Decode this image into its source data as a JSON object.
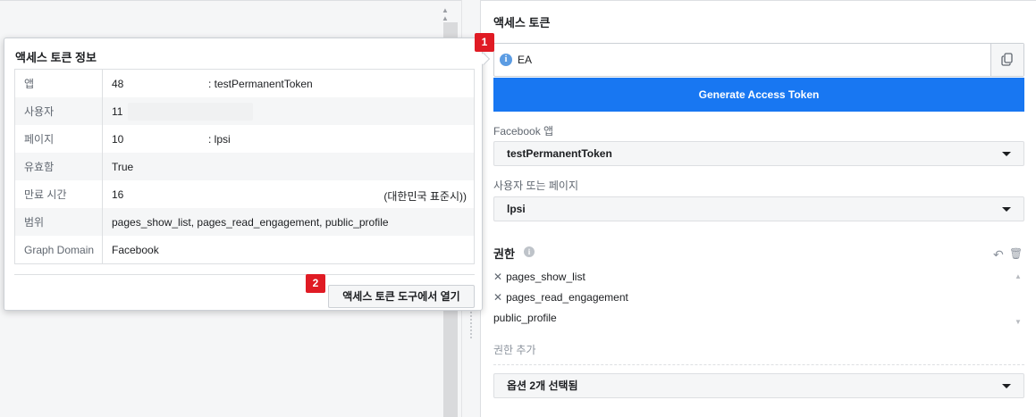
{
  "right_panel": {
    "section_title": "액세스 토큰",
    "token_value": "EA",
    "generate_button": "Generate Access Token",
    "facebook_app_label": "Facebook 앱",
    "facebook_app_value": "testPermanentToken",
    "user_or_page_label": "사용자 또는 페이지",
    "user_or_page_value": "lpsi",
    "permissions_title": "권한",
    "permissions": [
      {
        "label": "pages_show_list",
        "removable": true
      },
      {
        "label": "pages_read_engagement",
        "removable": true
      },
      {
        "label": "public_profile",
        "removable": false
      }
    ],
    "add_permission_placeholder": "권한 추가",
    "options_select_value": "옵션 2개 선택됨"
  },
  "popover": {
    "title": "액세스 토큰 정보",
    "rows": [
      {
        "key": "앱",
        "value": "48",
        "sub": ": testPermanentToken",
        "right": ""
      },
      {
        "key": "사용자",
        "value": "11",
        "sub": "",
        "right": ""
      },
      {
        "key": "페이지",
        "value": "10",
        "sub": ": lpsi",
        "right": ""
      },
      {
        "key": "유효함",
        "value": "True",
        "sub": "",
        "right": ""
      },
      {
        "key": "만료 시간",
        "value": "16",
        "sub": "",
        "right": "(대한민국 표준시))"
      },
      {
        "key": "범위",
        "value": "pages_show_list, pages_read_engagement, public_profile",
        "sub": "",
        "right": ""
      },
      {
        "key": "Graph Domain",
        "value": "Facebook",
        "sub": "",
        "right": ""
      }
    ],
    "open_tool_button": "액세스 토큰 도구에서 열기"
  },
  "badges": {
    "one": "1",
    "two": "2"
  },
  "colors": {
    "primary": "#1877f2",
    "badge": "#e01b24"
  },
  "icons": {
    "info": "info-icon",
    "copy": "copy-icon",
    "caret": "caret-down-icon",
    "undo": "undo-icon",
    "trash": "trash-icon",
    "remove": "x-icon"
  }
}
